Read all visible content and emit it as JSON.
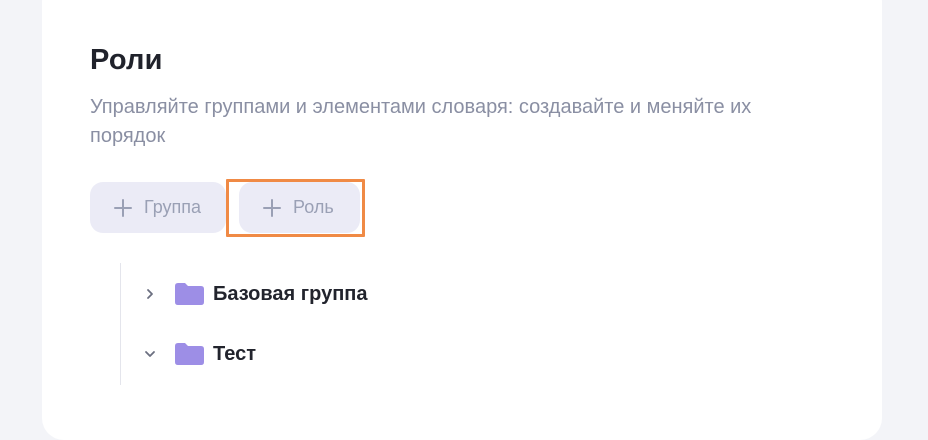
{
  "page": {
    "title": "Роли",
    "subtitle": "Управляйте группами и элементами словаря: создавайте и меняйте их порядок"
  },
  "toolbar": {
    "add_group": {
      "icon": "plus-icon",
      "label": "Группа"
    },
    "add_role": {
      "icon": "plus-icon",
      "label": "Роль"
    }
  },
  "tree": {
    "items": [
      {
        "label": "Базовая группа",
        "expanded": false,
        "chevron_icon": "chevron-right-icon",
        "folder_icon": "folder-icon"
      },
      {
        "label": "Тест",
        "expanded": true,
        "chevron_icon": "chevron-down-icon",
        "folder_icon": "folder-icon"
      }
    ]
  },
  "colors": {
    "background": "#f3f4f8",
    "card": "#ffffff",
    "title": "#20222b",
    "subtitle": "#8a8fa3",
    "button_bg": "#ebebf6",
    "button_text": "#9aa0b5",
    "highlight": "#f08a45",
    "folder": "#9d8ee6"
  }
}
